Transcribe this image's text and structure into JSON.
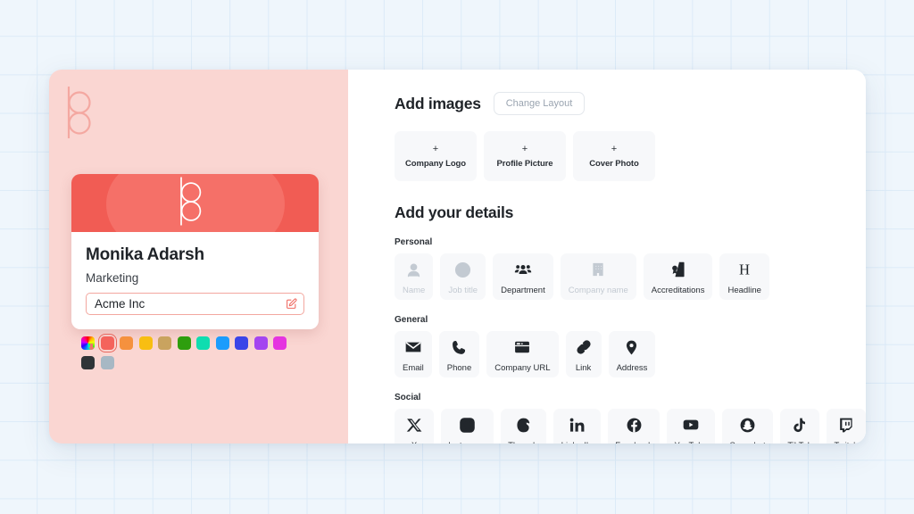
{
  "brand": {
    "logo_name": "bo-monogram-logo"
  },
  "preview": {
    "name": "Monika Adarsh",
    "role": "Marketing",
    "company": "Acme Inc",
    "company_field_editable": true,
    "edit_icon": "edit-pencil-icon",
    "banner_color": "#f15c54",
    "banner_highlight_color": "#f57068"
  },
  "swatches": {
    "selected_index": 1,
    "items": [
      {
        "name": "custom-color-picker",
        "color": "rainbow"
      },
      {
        "name": "color-red",
        "color": "#f4635c"
      },
      {
        "name": "color-orange",
        "color": "#f5913e"
      },
      {
        "name": "color-amber",
        "color": "#f8be12"
      },
      {
        "name": "color-tan",
        "color": "#c9a35f"
      },
      {
        "name": "color-green",
        "color": "#2e9e0e"
      },
      {
        "name": "color-teal",
        "color": "#0fddb0"
      },
      {
        "name": "color-blue",
        "color": "#1b9cfc"
      },
      {
        "name": "color-indigo",
        "color": "#3b44e8"
      },
      {
        "name": "color-purple",
        "color": "#a445f0"
      },
      {
        "name": "color-magenta",
        "color": "#e534e0"
      },
      {
        "name": "color-charcoal",
        "color": "#2f3437"
      },
      {
        "name": "color-slate-grey",
        "color": "#a7b8c4"
      }
    ]
  },
  "images_section": {
    "title": "Add images",
    "change_layout_label": "Change Layout",
    "tiles": [
      {
        "plus": "+",
        "label": "Company Logo"
      },
      {
        "plus": "+",
        "label": "Profile Picture"
      },
      {
        "plus": "+",
        "label": "Cover Photo"
      }
    ]
  },
  "details_section": {
    "title": "Add your details",
    "groups": [
      {
        "label": "Personal",
        "items": [
          {
            "label": "Name",
            "icon": "person-outline-icon",
            "disabled": true
          },
          {
            "label": "Job title",
            "icon": "job-badge-icon",
            "disabled": true
          },
          {
            "label": "Department",
            "icon": "people-group-icon",
            "disabled": false
          },
          {
            "label": "Company name",
            "icon": "building-icon",
            "disabled": true
          },
          {
            "label": "Accreditations",
            "icon": "certificate-doc-icon",
            "disabled": false
          },
          {
            "label": "Headline",
            "icon": "heading-h-icon",
            "disabled": false
          }
        ]
      },
      {
        "label": "General",
        "items": [
          {
            "label": "Email",
            "icon": "envelope-icon",
            "disabled": false
          },
          {
            "label": "Phone",
            "icon": "phone-icon",
            "disabled": false
          },
          {
            "label": "Company URL",
            "icon": "browser-window-icon",
            "disabled": false
          },
          {
            "label": "Link",
            "icon": "chain-link-icon",
            "disabled": false
          },
          {
            "label": "Address",
            "icon": "map-pin-icon",
            "disabled": false
          }
        ]
      },
      {
        "label": "Social",
        "items": [
          {
            "label": "X",
            "icon": "x-twitter-icon",
            "disabled": false
          },
          {
            "label": "Instagram",
            "icon": "instagram-icon",
            "disabled": false
          },
          {
            "label": "Threads",
            "icon": "threads-icon",
            "disabled": false
          },
          {
            "label": "LinkedIn",
            "icon": "linkedin-icon",
            "disabled": false
          },
          {
            "label": "Facebook",
            "icon": "facebook-icon",
            "disabled": false
          },
          {
            "label": "YouTube",
            "icon": "youtube-icon",
            "disabled": false
          },
          {
            "label": "Snapchat",
            "icon": "snapchat-icon",
            "disabled": false
          },
          {
            "label": "TikTok",
            "icon": "tiktok-icon",
            "disabled": false
          },
          {
            "label": "Twitch",
            "icon": "twitch-icon",
            "disabled": false
          }
        ]
      }
    ]
  }
}
